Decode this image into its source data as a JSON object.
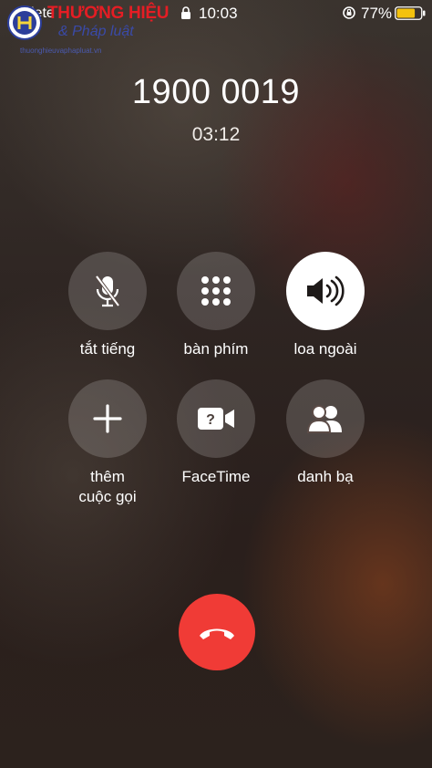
{
  "status_bar": {
    "carrier": "iete",
    "time": "10:03",
    "battery_percent": "77%",
    "battery_level": 0.77,
    "icons": [
      "lock-icon",
      "rotation-lock-icon",
      "battery-icon"
    ]
  },
  "watermark": {
    "title": "THƯƠNG HIỆU",
    "subtitle": "& Pháp luật",
    "url": "thuonghieuvaphapluat.vn"
  },
  "call": {
    "number": "1900 0019",
    "duration": "03:12"
  },
  "controls": [
    {
      "label": "tắt tiếng",
      "icon": "mute-icon",
      "active": false
    },
    {
      "label": "bàn phím",
      "icon": "keypad-icon",
      "active": false
    },
    {
      "label": "loa ngoài",
      "icon": "speaker-icon",
      "active": true
    },
    {
      "label_line1": "thêm",
      "label_line2": "cuộc gọi",
      "icon": "add-call-icon",
      "active": false
    },
    {
      "label": "FaceTime",
      "icon": "facetime-icon",
      "active": false
    },
    {
      "label": "danh bạ",
      "icon": "contacts-icon",
      "active": false
    }
  ],
  "end_call": {
    "icon": "end-call-icon",
    "color": "#f03b36"
  },
  "colors": {
    "end_call": "#f03b36",
    "battery_fill": "#f4c20d",
    "control_active": "#ffffff"
  }
}
